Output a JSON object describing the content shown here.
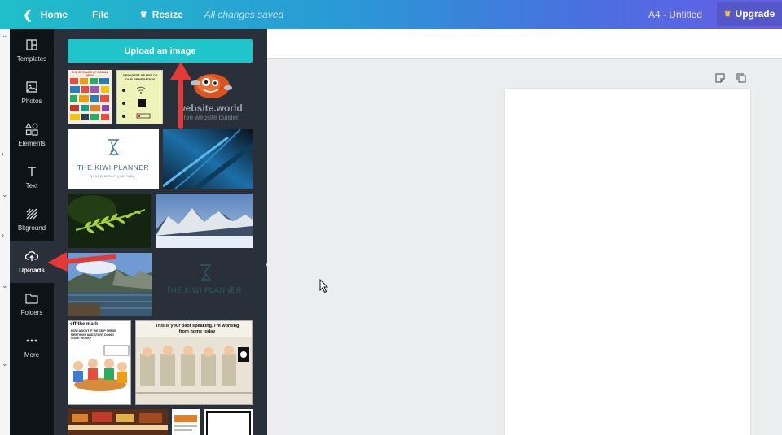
{
  "topbar": {
    "home_label": "Home",
    "file_label": "File",
    "resize_label": "Resize",
    "saved_status": "All changes saved",
    "doc_title": "A4 - Untitled",
    "upgrade_label": "Upgrade"
  },
  "sidebar": {
    "items": [
      {
        "label": "Templates",
        "icon": "templates-icon"
      },
      {
        "label": "Photos",
        "icon": "photos-icon"
      },
      {
        "label": "Elements",
        "icon": "elements-icon"
      },
      {
        "label": "Text",
        "icon": "text-icon"
      },
      {
        "label": "Bkground",
        "icon": "background-icon"
      },
      {
        "label": "Uploads",
        "icon": "upload-cloud-icon",
        "active": true
      },
      {
        "label": "Folders",
        "icon": "folder-icon"
      },
      {
        "label": "More",
        "icon": "more-icon"
      }
    ]
  },
  "panel": {
    "upload_button": "Upload an image",
    "thumbnails": {
      "social_media": "THE 25 RULES OF SOCIAL MEDIA",
      "biggest_fears": "3 BIGGEST FEARS OF OUR GENERATION",
      "website_world": "website.world",
      "website_world_sub": "free website builder",
      "kiwi_title": "THE KIWI PLANNER",
      "kiwi_sub": "your planner. your way.",
      "kiwi_dark_title": "THE KIWI PLANNER",
      "comic1_head": "off the mark",
      "comic1_text": "HOW ABOUT IF WE SKIP THESE MEETINGS AND START DOING SOME WORK?",
      "comic2_text": "This is your pilot speaking. I'm working from home today"
    }
  },
  "colors": {
    "accent": "#20c4cb",
    "sidebar_bg": "#0e1318",
    "panel_bg": "#293039",
    "arrow_red": "#e53935"
  }
}
